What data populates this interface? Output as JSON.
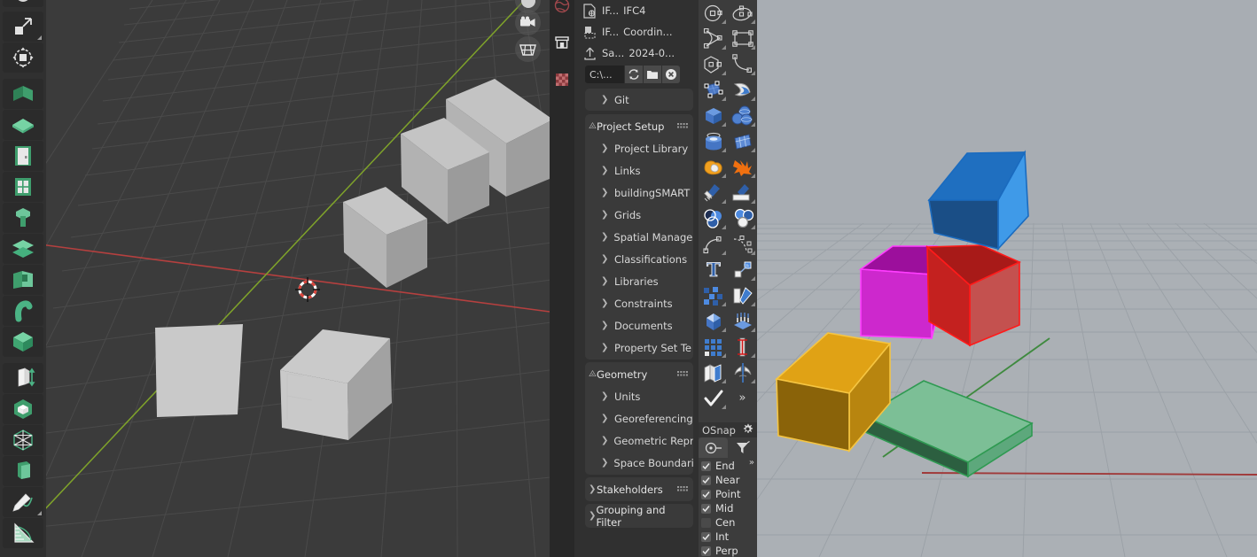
{
  "app": {
    "name": "Blender + BlenderBIM / Bonsai alongside CAD viewport"
  },
  "left_toolbar": {
    "items": [
      {
        "name": "tool-annotate-partial",
        "label": "Annotate"
      },
      {
        "name": "tool-scale",
        "label": "Scale"
      },
      {
        "name": "tool-transform",
        "label": "Transform"
      },
      {
        "name": "tool-wall",
        "label": "Wall"
      },
      {
        "name": "tool-slab",
        "label": "Slab"
      },
      {
        "name": "tool-door",
        "label": "Door"
      },
      {
        "name": "tool-window",
        "label": "Window"
      },
      {
        "name": "tool-duct",
        "label": "Duct"
      },
      {
        "name": "tool-column",
        "label": "Column"
      },
      {
        "name": "tool-stair",
        "label": "Stair"
      },
      {
        "name": "tool-railing",
        "label": "Railing"
      },
      {
        "name": "tool-pipe",
        "label": "Pipe"
      },
      {
        "name": "tool-generic-solid",
        "label": "Generic Solid"
      },
      {
        "name": "tool-extrusion-depth",
        "label": "Extrusion Depth"
      },
      {
        "name": "tool-void",
        "label": "Void"
      },
      {
        "name": "tool-structural",
        "label": "Structural"
      },
      {
        "name": "tool-sheet",
        "label": "Sheet"
      },
      {
        "name": "tool-annotate",
        "label": "Annotate"
      },
      {
        "name": "tool-measure",
        "label": "Measure"
      }
    ]
  },
  "viewport_left": {
    "gizmo_buttons": [
      {
        "name": "navigation-gizmo",
        "label": "Navigation Gizmo"
      },
      {
        "name": "camera-view-button",
        "label": "Camera View"
      },
      {
        "name": "toggle-grid-button",
        "label": "Toggle Grid / Orthographic"
      }
    ],
    "objects": [
      "cube-1",
      "cube-2",
      "cube-3",
      "cube-4",
      "plane-1"
    ],
    "cursor": "3d-cursor"
  },
  "red_column": {
    "items": [
      {
        "name": "world-properties-icon",
        "label": "World"
      },
      {
        "name": "collection-properties-icon",
        "label": "Collection"
      },
      {
        "name": "material-properties-icon",
        "label": "Material"
      }
    ]
  },
  "ifc_panel": {
    "file_rows": [
      {
        "icon": "ifc-schema-icon",
        "label_short": "IF...",
        "label": "IFC4"
      },
      {
        "icon": "ifc-coordinates-icon",
        "label_short": "IF...",
        "label": "Coordin..."
      },
      {
        "icon": "save-upload-icon",
        "label_short": "Sa...",
        "label": "2024-0..."
      }
    ],
    "path_field": {
      "value": "C:\\...",
      "placeholder": "C:\\",
      "buttons": [
        {
          "name": "reload-path-button",
          "label": "Reload"
        },
        {
          "name": "browse-folder-button",
          "label": "Browse"
        },
        {
          "name": "clear-path-button",
          "label": "Clear"
        }
      ]
    },
    "git_section": {
      "label": "Git",
      "expanded": false
    },
    "sections": [
      {
        "name": "project-setup",
        "label": "Project Setup",
        "expanded": true,
        "items": [
          {
            "label": "Project Library"
          },
          {
            "label": "Links"
          },
          {
            "label": "buildingSMART"
          },
          {
            "label": "Grids"
          },
          {
            "label": "Spatial Manager"
          },
          {
            "label": "Classifications"
          },
          {
            "label": "Libraries"
          },
          {
            "label": "Constraints"
          },
          {
            "label": "Documents"
          },
          {
            "label": "Property Set Te"
          }
        ]
      },
      {
        "name": "geometry",
        "label": "Geometry",
        "expanded": true,
        "items": [
          {
            "label": "Units"
          },
          {
            "label": "Georeferencing"
          },
          {
            "label": "Geometric Repr"
          },
          {
            "label": "Space Boundari"
          }
        ]
      },
      {
        "name": "stakeholders",
        "label": "Stakeholders",
        "expanded": false,
        "items": []
      },
      {
        "name": "grouping-and-filter",
        "label": "Grouping and Filter",
        "expanded": false,
        "items": []
      }
    ]
  },
  "cad_palette": {
    "tools": [
      {
        "name": "circle-center-tool",
        "label": "Circle by Center",
        "flyout": true
      },
      {
        "name": "ellipse-tool",
        "label": "Ellipse",
        "flyout": true
      },
      {
        "name": "arc-tool",
        "label": "Arc",
        "flyout": true
      },
      {
        "name": "rectangle-tool",
        "label": "Rectangle",
        "flyout": true
      },
      {
        "name": "polygon-tool",
        "label": "Polygon",
        "flyout": true
      },
      {
        "name": "curve-tool",
        "label": "Curve / Fillet",
        "flyout": true
      },
      {
        "name": "surface-from-points-tool",
        "label": "Surface from Points",
        "flyout": true
      },
      {
        "name": "sweep-surface-tool",
        "label": "Sweep Surface",
        "flyout": true
      },
      {
        "name": "box-solid-tool",
        "label": "Box Solid",
        "flyout": true
      },
      {
        "name": "sphere-solid-tool",
        "label": "Sphere Solid",
        "flyout": true
      },
      {
        "name": "cylinder-solid-tool",
        "label": "Cylinder Solid",
        "flyout": true
      },
      {
        "name": "mesh-plane-tool",
        "label": "Mesh Plane",
        "flyout": true
      },
      {
        "name": "boolean-union-tool",
        "label": "Boolean Union",
        "flyout": true
      },
      {
        "name": "explode-tool",
        "label": "Explode",
        "flyout": true
      },
      {
        "name": "paint-tool",
        "label": "Paint",
        "flyout": true
      },
      {
        "name": "material-assign-tool",
        "label": "Assign Material",
        "flyout": true
      },
      {
        "name": "boolean-intersect-tool",
        "label": "Boolean Intersect",
        "flyout": true
      },
      {
        "name": "boolean-difference-tool",
        "label": "Boolean Difference",
        "flyout": true
      },
      {
        "name": "blend-curve-tool",
        "label": "Blend Curve",
        "flyout": true
      },
      {
        "name": "dashed-curve-tool",
        "label": "Dashed Curve",
        "flyout": true
      },
      {
        "name": "text-tool",
        "label": "Text",
        "flyout": false
      },
      {
        "name": "move-copy-tool",
        "label": "Move / Copy",
        "flyout": true
      },
      {
        "name": "array-tool",
        "label": "Array",
        "flyout": true
      },
      {
        "name": "gradient-tool",
        "label": "Gradient",
        "flyout": true
      },
      {
        "name": "extrude-solid-tool",
        "label": "Extrude Solid",
        "flyout": true
      },
      {
        "name": "contour-tool",
        "label": "Contour",
        "flyout": true
      },
      {
        "name": "grid-snap-tool",
        "label": "Grid Snap",
        "flyout": true
      },
      {
        "name": "dimension-tool",
        "label": "Dimension",
        "flyout": true
      },
      {
        "name": "layers-tool",
        "label": "Layers",
        "flyout": true
      },
      {
        "name": "mirror-tool",
        "label": "Mirror",
        "flyout": true
      },
      {
        "name": "check-tool",
        "label": "Accept / Check",
        "flyout": true
      },
      {
        "name": "more-tools-button",
        "label": "»",
        "flyout": false
      }
    ]
  },
  "osnap": {
    "title": "OSnap",
    "gear_icon": "gear-icon",
    "tabs": [
      {
        "name": "osnap-tab-snaps",
        "label": "Object Snaps",
        "icon": "endpoint-snap-icon",
        "active": true
      },
      {
        "name": "osnap-tab-filters",
        "label": "Selection Filters",
        "icon": "filter-icon",
        "active": false
      }
    ],
    "more_label": "»",
    "snaps": [
      {
        "label": "End",
        "checked": true
      },
      {
        "label": "Near",
        "checked": true
      },
      {
        "label": "Point",
        "checked": true
      },
      {
        "label": "Mid",
        "checked": true
      },
      {
        "label": "Cen",
        "checked": false
      },
      {
        "label": "Int",
        "checked": true
      },
      {
        "label": "Perp",
        "checked": true
      }
    ]
  },
  "viewport_right": {
    "background": "#abb0b5",
    "axis_colors": {
      "x": "#a03a3a",
      "y": "#3f8a3f"
    },
    "objects": [
      {
        "name": "cube-blue",
        "color": "#2a7fd4",
        "edge": "#1a6bbf"
      },
      {
        "name": "cube-red",
        "color": "#c4211f",
        "edge": "#ff1a1a"
      },
      {
        "name": "cube-magenta",
        "color": "#c418c4",
        "edge": "#ff3dff"
      },
      {
        "name": "cube-orange",
        "color": "#e0a215",
        "edge": "#f5c542"
      },
      {
        "name": "cube-green",
        "color": "#7cbf96",
        "edge": "#2f9a52"
      }
    ]
  }
}
